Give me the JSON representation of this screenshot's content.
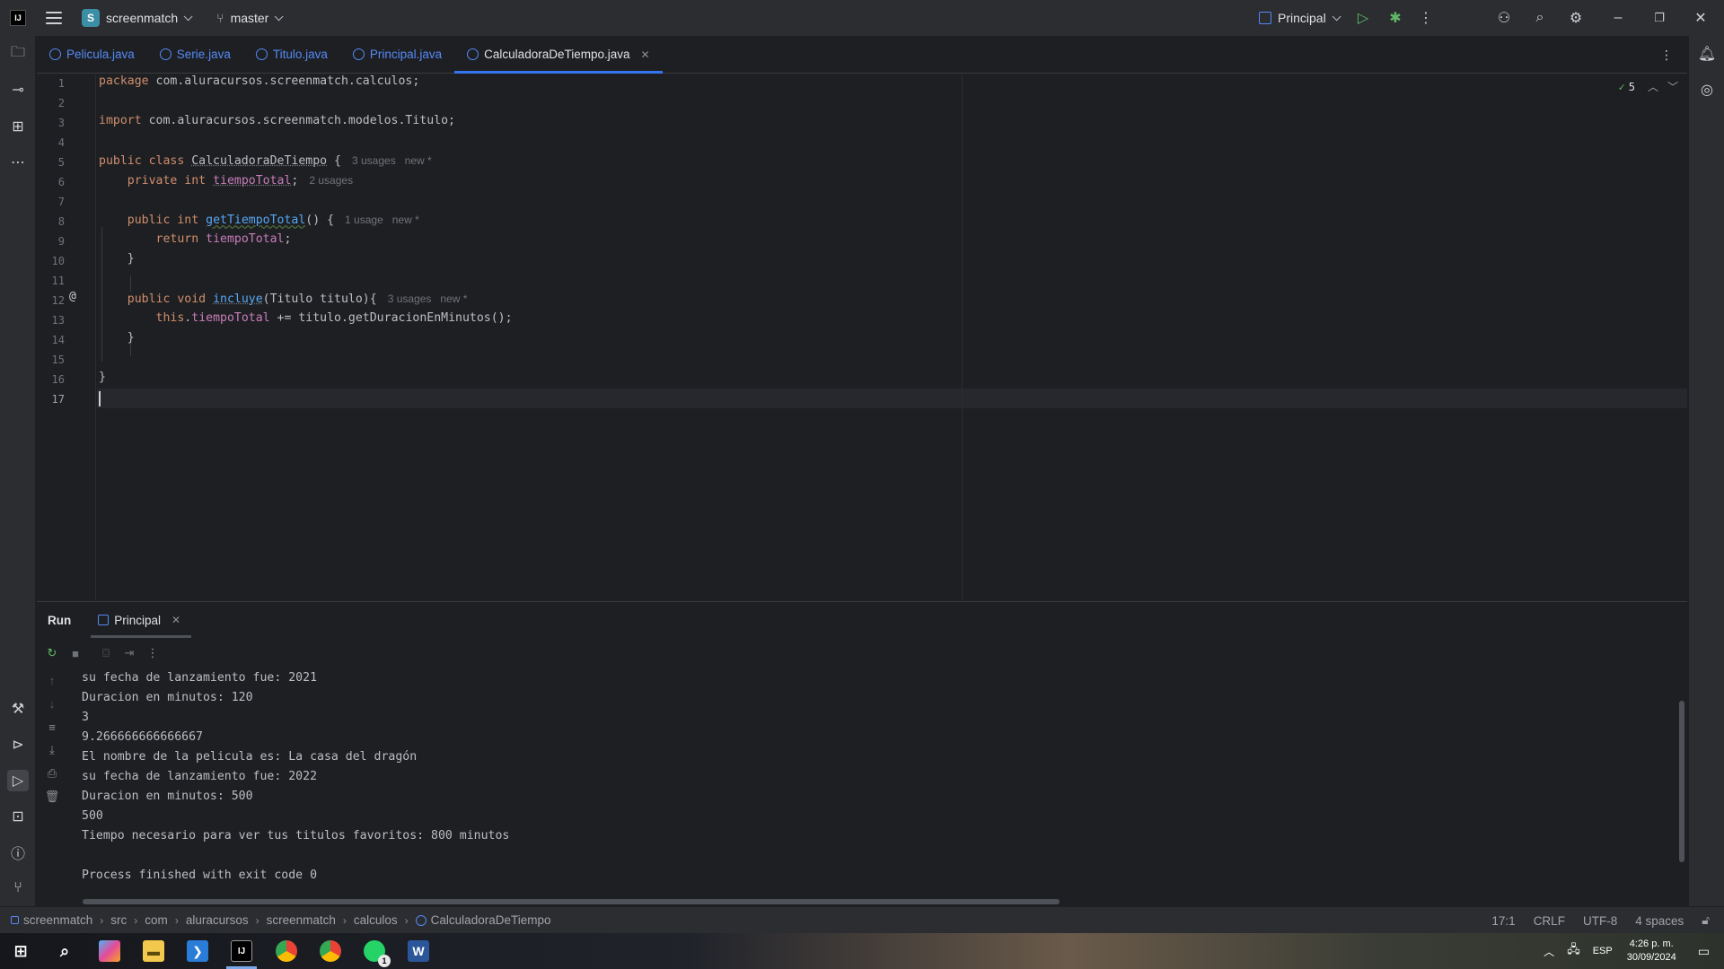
{
  "titlebar": {
    "project_name": "screenmatch",
    "project_badge": "S",
    "branch": "master",
    "run_config": "Principal"
  },
  "tabs": [
    {
      "label": "Pelicula.java"
    },
    {
      "label": "Serie.java"
    },
    {
      "label": "Titulo.java"
    },
    {
      "label": "Principal.java"
    },
    {
      "label": "CalculadoraDeTiempo.java",
      "active": true
    }
  ],
  "editor": {
    "inspection_count": "5",
    "line_numbers": [
      "1",
      "2",
      "3",
      "4",
      "5",
      "6",
      "7",
      "8",
      "9",
      "10",
      "11",
      "12",
      "13",
      "14",
      "15",
      "16",
      "17"
    ],
    "code": {
      "l1_kw": "package",
      "l1_rest": " com.aluracursos.screenmatch.calculos;",
      "l3_kw": "import",
      "l3_rest": " com.aluracursos.screenmatch.modelos.Titulo;",
      "l5_kw": "public class",
      "l5_cls": "CalculadoraDeTiempo",
      "l5_rest": " {",
      "l5_hint1": "3 usages",
      "l5_hint2": "new *",
      "l6_kw": "private int",
      "l6_fld": "tiempoTotal",
      "l6_rest": ";",
      "l6_hint1": "2 usages",
      "l8_kw": "public int",
      "l8_fn": "getTiempoTotal",
      "l8_rest": "() {",
      "l8_hint1": "1 usage",
      "l8_hint2": "new *",
      "l9_kw": "return",
      "l9_fld": "tiempoTotal",
      "l9_rest": ";",
      "l10": "}",
      "l12_kw": "public void",
      "l12_fn": "incluye",
      "l12_rest": "(Titulo titulo){",
      "l12_hint1": "3 usages",
      "l12_hint2": "new *",
      "l13_kw": "this",
      "l13_dot": ".",
      "l13_fld": "tiempoTotal",
      "l13_rest": " += titulo.getDuracionEnMinutos();",
      "l14": "}",
      "l16": "}",
      "at_marker": "@"
    }
  },
  "run_panel": {
    "title": "Run",
    "tab_label": "Principal",
    "console_lines": [
      "su fecha de lanzamiento fue: 2021",
      "Duracion en minutos: 120",
      "3",
      "9.266666666666667",
      "El nombre de la pelicula es: La casa del dragón",
      "su fecha de lanzamiento fue: 2022",
      "Duracion en minutos: 500",
      "500",
      "Tiempo necesario para ver tus titulos favoritos: 800 minutos",
      "",
      "Process finished with exit code 0"
    ]
  },
  "statusbar": {
    "breadcrumbs": [
      "screenmatch",
      "src",
      "com",
      "aluracursos",
      "screenmatch",
      "calculos",
      "CalculadoraDeTiempo"
    ],
    "position": "17:1",
    "line_ending": "CRLF",
    "encoding": "UTF-8",
    "indent": "4 spaces"
  },
  "taskbar": {
    "language": "ESP",
    "time": "4:26 p. m.",
    "date": "30/09/2024",
    "whatsapp_badge": "1"
  },
  "colors": {
    "accent": "#3574f0",
    "keyword": "#cf8e6d",
    "field": "#c77dbb",
    "function": "#56a8f5",
    "tab_link": "#548af7"
  }
}
